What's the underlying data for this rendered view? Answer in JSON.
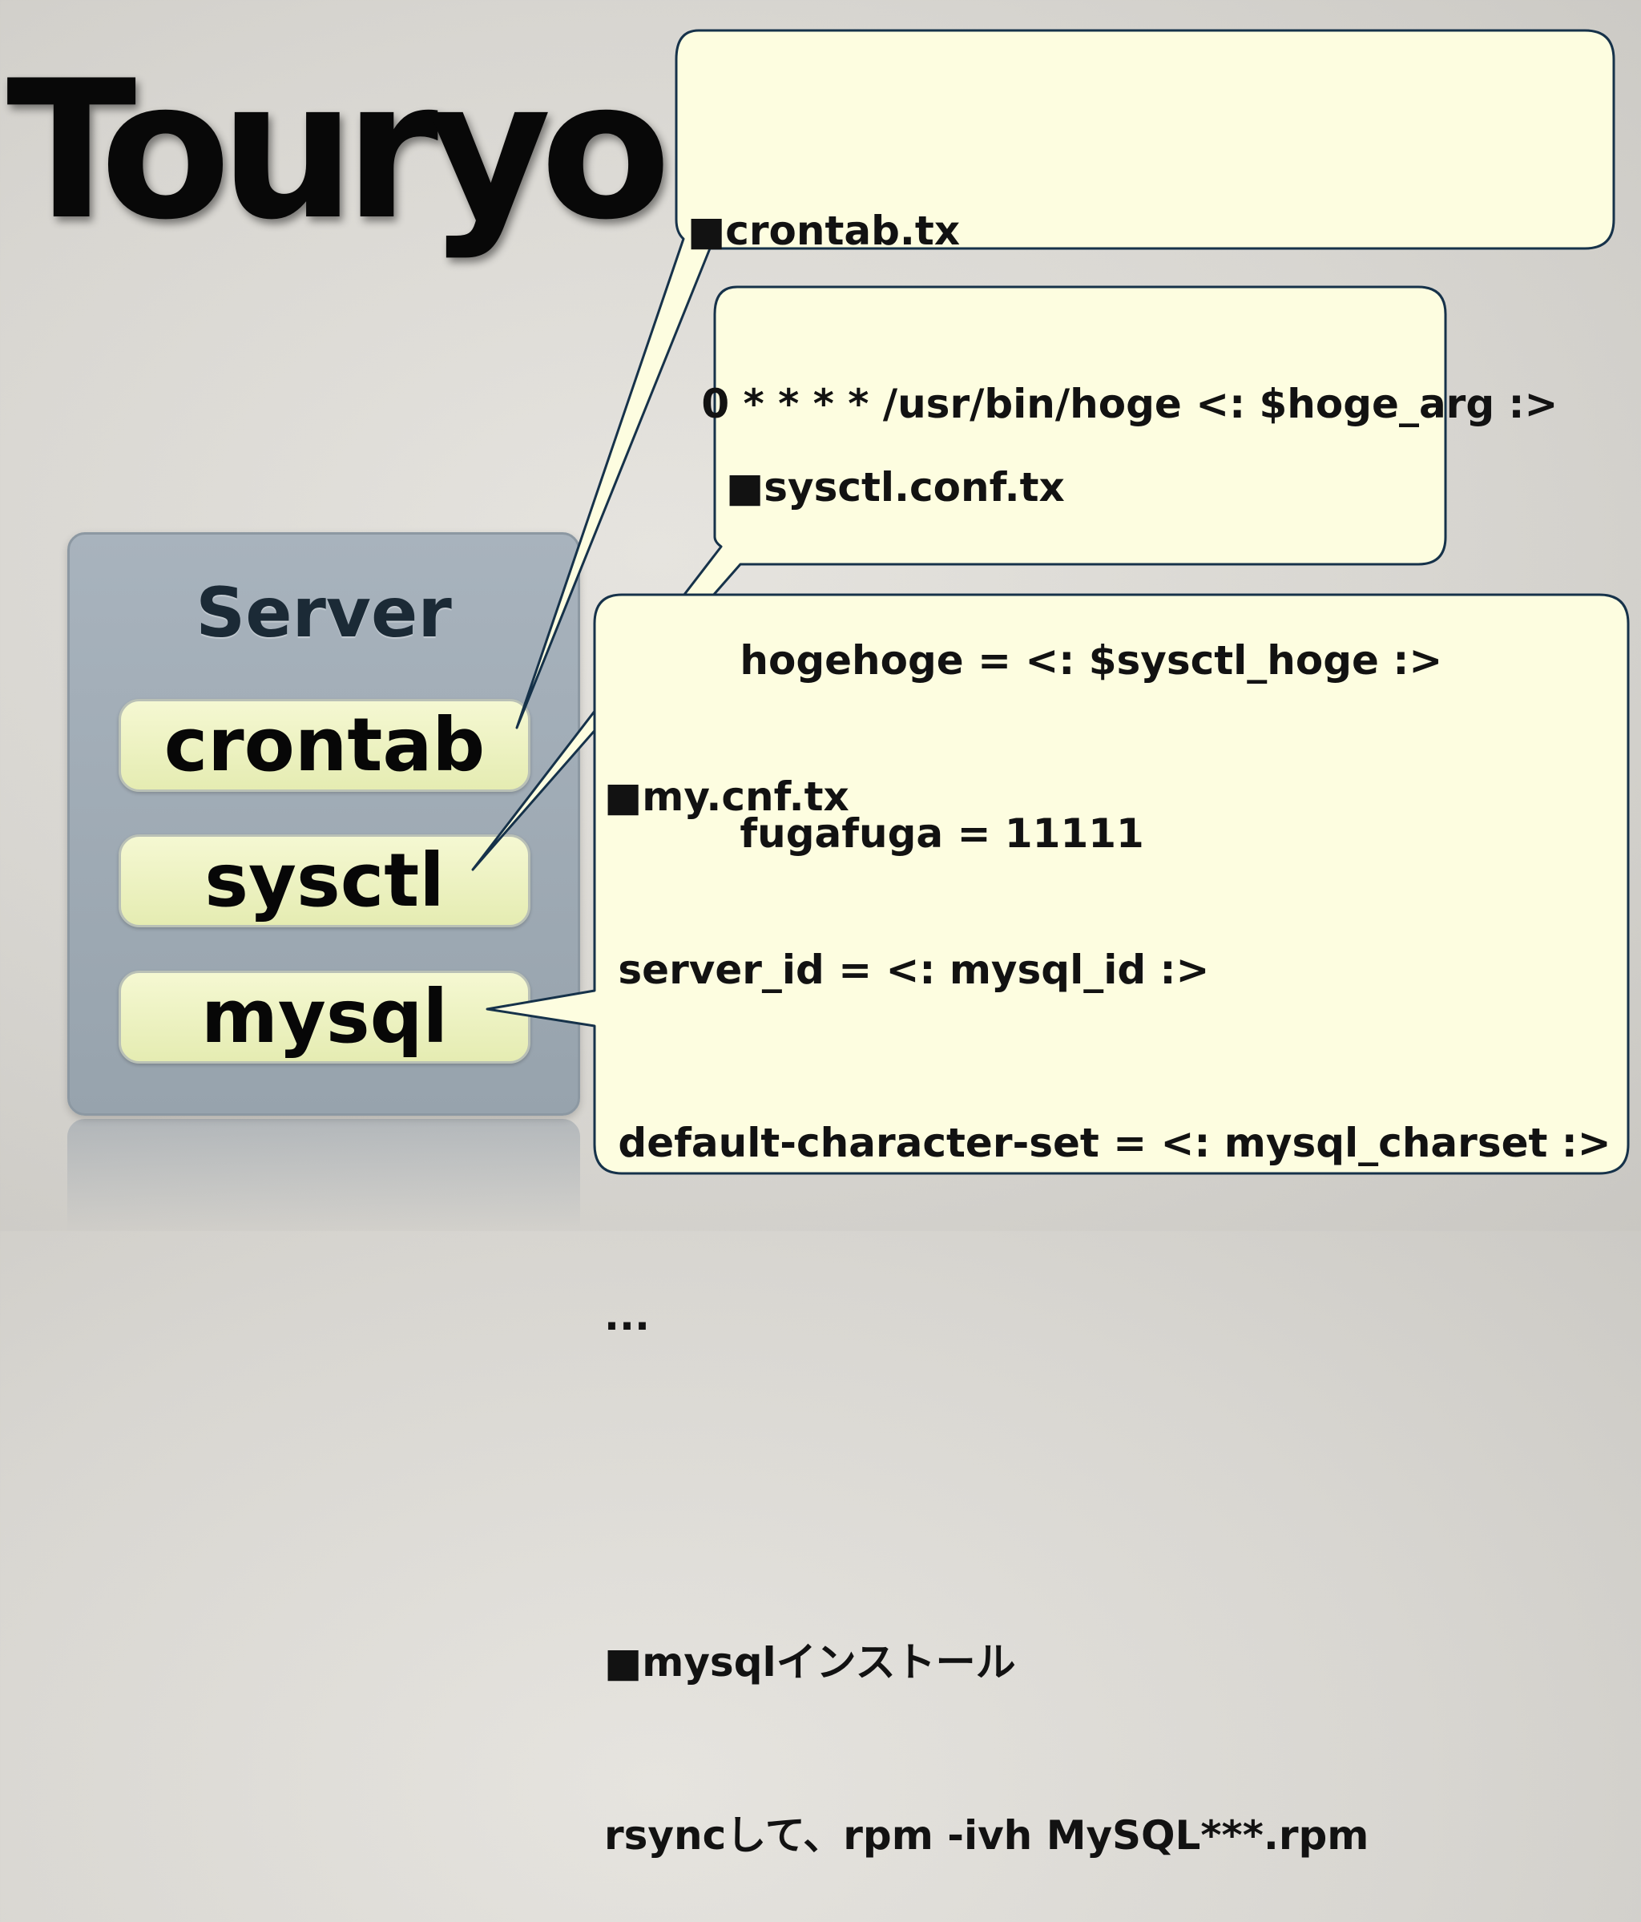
{
  "slide": {
    "title": "Touryo"
  },
  "server": {
    "label": "Server",
    "components": [
      "crontab",
      "sysctl",
      "mysql"
    ]
  },
  "callouts": {
    "crontab": {
      "lines": [
        "■crontab.tx",
        " 0 * * * * /usr/bin/hoge <: $hoge_arg :>"
      ]
    },
    "sysctl": {
      "lines": [
        "■sysctl.conf.tx",
        " hogehoge = <: $sysctl_hoge :>",
        " fugafuga = 11111"
      ]
    },
    "mysql": {
      "lines": [
        "■my.cnf.tx",
        " server_id = <: mysql_id :>",
        " default-character-set = <: mysql_charset :>",
        "...",
        "",
        "■mysqlインストール",
        "rsyncして、rpm -ivh MySQL***.rpm"
      ]
    }
  },
  "colors": {
    "callout_fill": "#fdfde0",
    "callout_stroke": "#16324a",
    "server_panel": "#9ea9b3",
    "component_fill": "#eef3c4",
    "title_text": "#080808"
  }
}
